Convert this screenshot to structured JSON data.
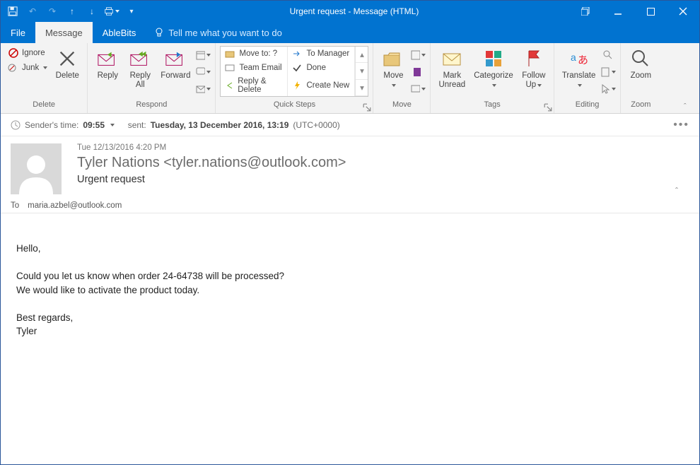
{
  "window": {
    "title": "Urgent request  -  Message (HTML)"
  },
  "tabs": {
    "file": "File",
    "message": "Message",
    "ablebits": "AbleBits",
    "tellme": "Tell me what you want to do"
  },
  "ribbon": {
    "delete": {
      "ignore": "Ignore",
      "junk": "Junk",
      "delete": "Delete",
      "group": "Delete"
    },
    "respond": {
      "reply": "Reply",
      "replyall": "Reply\nAll",
      "forward": "Forward",
      "group": "Respond"
    },
    "quicksteps": {
      "moveto": "Move to: ?",
      "teamemail": "Team Email",
      "replydelete": "Reply & Delete",
      "tomanager": "To Manager",
      "done": "Done",
      "createnew": "Create New",
      "group": "Quick Steps"
    },
    "move": {
      "move": "Move",
      "group": "Move"
    },
    "tags": {
      "markunread": "Mark\nUnread",
      "categorize": "Categorize",
      "followup": "Follow\nUp",
      "group": "Tags"
    },
    "editing": {
      "translate": "Translate",
      "group": "Editing"
    },
    "zoom": {
      "zoom": "Zoom",
      "group": "Zoom"
    }
  },
  "senderbar": {
    "prefix": "Sender's time:",
    "sendertime": "09:55",
    "sentlabel": "sent:",
    "sentvalue": "Tuesday, 13 December 2016, 13:19",
    "tz": "(UTC+0000)"
  },
  "header": {
    "received": "Tue 12/13/2016 4:20 PM",
    "from": "Tyler Nations <tyler.nations@outlook.com>",
    "subject": "Urgent request",
    "tolabel": "To",
    "to": "maria.azbel@outlook.com"
  },
  "body": {
    "l1": "Hello,",
    "l2": "Could you let us know when order 24-64738 will be processed?",
    "l3": "We would like to activate the product today.",
    "l4": "Best regards,",
    "l5": "Tyler"
  }
}
